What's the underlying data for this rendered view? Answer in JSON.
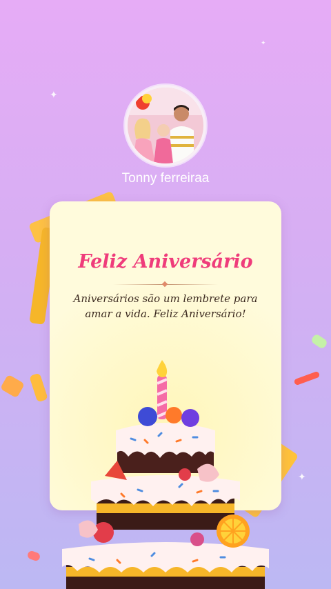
{
  "profile": {
    "username": "Tonny ferreiraa",
    "avatar_icon": "family-photo-avatar"
  },
  "card": {
    "title": "Feliz Aniversário",
    "message": "Aniversários são um lembrete para amar a vida. Feliz Aniversário!",
    "illustration_icon": "birthday-cake-icon"
  },
  "colors": {
    "background_top": "#e6acf6",
    "background_bottom": "#bcb8f3",
    "card": "#fffbdc",
    "title": "#ef3c7b",
    "ribbon": "#ffc23a"
  }
}
